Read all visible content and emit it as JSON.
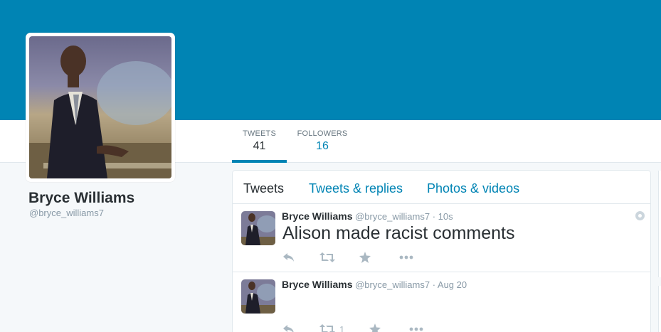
{
  "profile": {
    "name": "Bryce Williams",
    "handle": "@bryce_williams7",
    "banner_color": "#0084b4"
  },
  "stats": {
    "tweets_label": "TWEETS",
    "tweets_value": "41",
    "followers_label": "FOLLOWERS",
    "followers_value": "16"
  },
  "timeline": {
    "tabs": [
      "Tweets",
      "Tweets & replies",
      "Photos & videos"
    ],
    "tweets": [
      {
        "name": "Bryce Williams",
        "handle": "@bryce_williams7",
        "time": "· 10s",
        "text": "Alison made racist comments"
      },
      {
        "name": "Bryce Williams",
        "handle": "@bryce_williams7",
        "time": "· Aug 20",
        "text": "",
        "retweet_count": "1"
      }
    ]
  },
  "icons": [
    "reply-icon",
    "retweet-icon",
    "favorite-icon",
    "more-icon",
    "geo-icon"
  ],
  "colors": {
    "accent": "#0084b4",
    "muted": "#8899a6",
    "text": "#292f33"
  }
}
